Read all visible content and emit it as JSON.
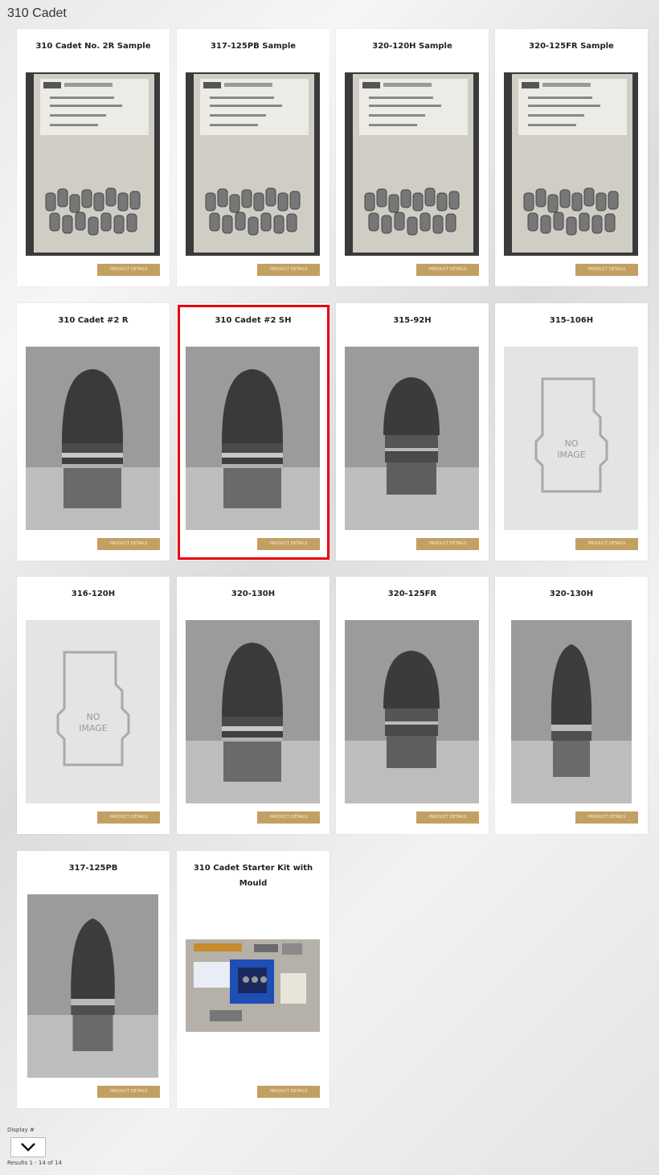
{
  "page": {
    "title": "310 Cadet"
  },
  "products": [
    {
      "title": "310 Cadet No. 2R Sample",
      "image": "sample-bag",
      "button": "PRODUCT DETAILS"
    },
    {
      "title": "317-125PB Sample",
      "image": "sample-bag",
      "button": "PRODUCT DETAILS"
    },
    {
      "title": "320-120H Sample",
      "image": "sample-bag",
      "button": "PRODUCT DETAILS"
    },
    {
      "title": "320-125FR Sample",
      "image": "sample-bag",
      "button": "PRODUCT DETAILS"
    },
    {
      "title": "310 Cadet #2 R",
      "image": "bullet-round",
      "button": "PRODUCT DETAILS"
    },
    {
      "title": "310 Cadet #2 SH",
      "image": "bullet-round",
      "button": "PRODUCT DETAILS",
      "selected": true
    },
    {
      "title": "315-92H",
      "image": "bullet-flat",
      "button": "PRODUCT DETAILS"
    },
    {
      "title": "315-106H",
      "image": "no-image",
      "button": "PRODUCT DETAILS",
      "no_image_text": "NO IMAGE"
    },
    {
      "title": "316-120H",
      "image": "no-image",
      "button": "PRODUCT DETAILS",
      "no_image_text": "NO IMAGE"
    },
    {
      "title": "320-130H",
      "image": "bullet-round",
      "button": "PRODUCT DETAILS"
    },
    {
      "title": "320-125FR",
      "image": "bullet-flat",
      "button": "PRODUCT DETAILS"
    },
    {
      "title": "320-130H",
      "image": "bullet-pointed",
      "button": "PRODUCT DETAILS"
    },
    {
      "title": "317-125PB",
      "image": "bullet-pointed",
      "button": "PRODUCT DETAILS"
    },
    {
      "title": "310 Cadet Starter Kit with Mould",
      "image": "kit",
      "button": "PRODUCT DETAILS"
    }
  ],
  "footer": {
    "display_label": "Display #",
    "display_select_icon": "chevron-down-icon",
    "results_text": "Results 1 - 14 of 14"
  },
  "colors": {
    "button": "#c2a063",
    "highlight": "#e8000b"
  }
}
